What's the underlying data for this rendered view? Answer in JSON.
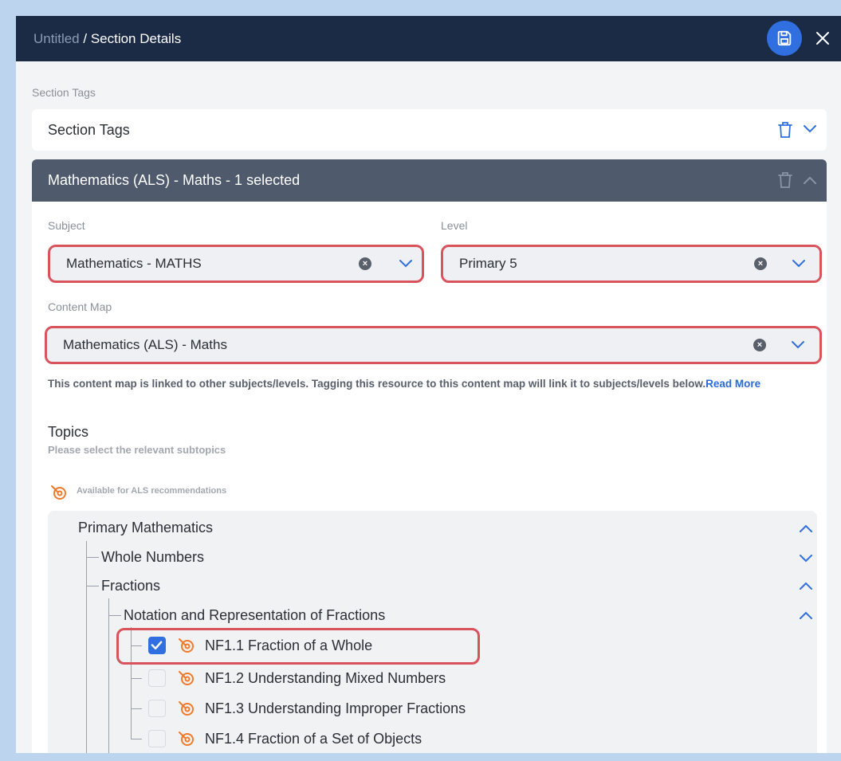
{
  "header": {
    "breadcrumb_parent": "Untitled",
    "breadcrumb_separator": " / ",
    "breadcrumb_current": "Section Details"
  },
  "section_tags": {
    "label": "Section Tags",
    "box_title": "Section Tags"
  },
  "tag_group": {
    "title": "Mathematics (ALS) - Maths - 1 selected",
    "subject_label": "Subject",
    "subject_value": "Mathematics - MATHS",
    "level_label": "Level",
    "level_value": "Primary 5",
    "content_map_label": "Content Map",
    "content_map_value": "Mathematics (ALS) - Maths",
    "note_text": "This content map is linked to other subjects/levels. Tagging this resource to this content map will link it to subjects/levels below.",
    "note_link": "Read More",
    "topics_title": "Topics",
    "topics_subtitle": "Please select the relevant subtopics",
    "als_legend": "Available for ALS recommendations"
  },
  "tree": {
    "root": "Primary Mathematics",
    "whole_numbers": "Whole Numbers",
    "fractions": "Fractions",
    "notation": "Notation and Representation of Fractions",
    "items": [
      {
        "label": "NF1.1 Fraction of a Whole",
        "checked": true
      },
      {
        "label": "NF1.2 Understanding Mixed Numbers",
        "checked": false
      },
      {
        "label": "NF1.3 Understanding Improper Fractions",
        "checked": false
      },
      {
        "label": "NF1.4 Fraction of a Set of Objects",
        "checked": false
      }
    ]
  },
  "colors": {
    "header_bg": "#1b2a45",
    "accent": "#2f6fe0",
    "highlight": "#d9535d",
    "als_icon": "#f07a2a"
  }
}
